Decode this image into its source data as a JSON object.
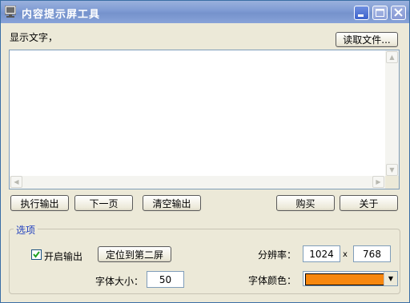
{
  "window": {
    "title": "内容提示屏工具"
  },
  "display_text_label": "显示文字，",
  "display_text_value": "",
  "buttons": {
    "read_file": "读取文件...",
    "execute_output": "执行输出",
    "next_page": "下一页",
    "clear_output": "清空输出",
    "buy": "购买",
    "about": "关于",
    "locate_second_screen": "定位到第二屏"
  },
  "options": {
    "group_title": "选项",
    "enable_output_label": "开启输出",
    "enable_output_checked": true,
    "resolution_label": "分辨率：",
    "resolution_width": "1024",
    "resolution_sep": "x",
    "resolution_height": "768",
    "font_size_label": "字体大小：",
    "font_size_value": "50",
    "font_color_label": "字体颜色：",
    "font_color": "#F7870F"
  },
  "colors": {
    "title_bar": "#7E9AD3",
    "group_title": "#1F3FBF"
  }
}
